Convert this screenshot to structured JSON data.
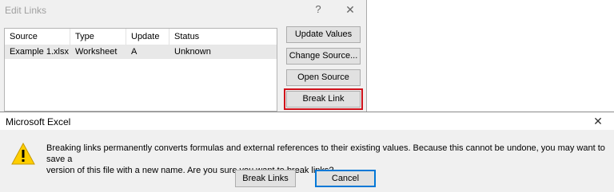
{
  "edit_links": {
    "title": "Edit Links",
    "help_glyph": "?",
    "close_glyph": "✕",
    "columns": [
      "Source",
      "Type",
      "Update",
      "Status"
    ],
    "rows": [
      {
        "source": "Example 1.xlsx",
        "type": "Worksheet",
        "update": "A",
        "status": "Unknown"
      }
    ],
    "buttons": {
      "update_values": "Update Values",
      "change_source": "Change Source...",
      "open_source": "Open Source",
      "break_link": "Break Link"
    },
    "highlight_color": "#d0121b"
  },
  "message_box": {
    "title": "Microsoft Excel",
    "close_glyph": "✕",
    "icon": "warning-icon",
    "message_line1": "Breaking links permanently converts formulas and external references to their existing values. Because this cannot be undone, you may want to save a",
    "message_line2": "version of this file with a new name. Are you sure you want to break links?",
    "buttons": {
      "break_links": "Break Links",
      "cancel": "Cancel"
    },
    "accent_color": "#0078d7"
  }
}
